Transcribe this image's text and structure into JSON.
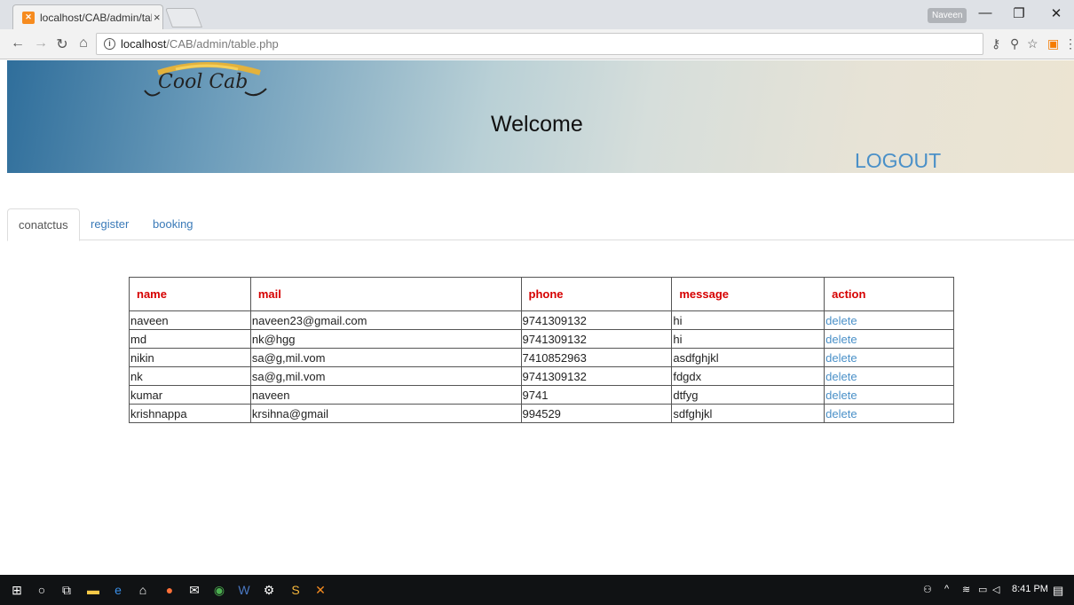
{
  "browser": {
    "tab_title": "localhost/CAB/admin/tab",
    "tab_close": "×",
    "profile_name": "Naveen",
    "url_host": "localhost",
    "url_path": "/CAB/admin/table.php"
  },
  "header": {
    "logo_text": "Cool Cab",
    "welcome": "Welcome",
    "logout": "LOGOUT"
  },
  "tabs": [
    {
      "label": "conatctus",
      "active": true
    },
    {
      "label": "register",
      "active": false
    },
    {
      "label": "booking",
      "active": false
    }
  ],
  "table": {
    "columns": [
      "name",
      "mail",
      "phone",
      "message",
      "action"
    ],
    "rows": [
      {
        "name": "naveen",
        "mail": "naveen23@gmail.com",
        "phone": "9741309132",
        "message": "hi",
        "action": "delete"
      },
      {
        "name": "md",
        "mail": "nk@hgg",
        "phone": "9741309132",
        "message": "hi",
        "action": "delete"
      },
      {
        "name": "nikin",
        "mail": "sa@g,mil.vom",
        "phone": "7410852963",
        "message": "asdfghjkl",
        "action": "delete"
      },
      {
        "name": "nk",
        "mail": "sa@g,mil.vom",
        "phone": "9741309132",
        "message": "fdgdx",
        "action": "delete"
      },
      {
        "name": "kumar",
        "mail": "naveen",
        "phone": "9741",
        "message": "dtfyg",
        "action": "delete"
      },
      {
        "name": "krishnappa",
        "mail": "krsihna@gmail",
        "phone": "994529",
        "message": "sdfghjkl",
        "action": "delete"
      }
    ]
  },
  "taskbar": {
    "time": "8:41 PM"
  }
}
